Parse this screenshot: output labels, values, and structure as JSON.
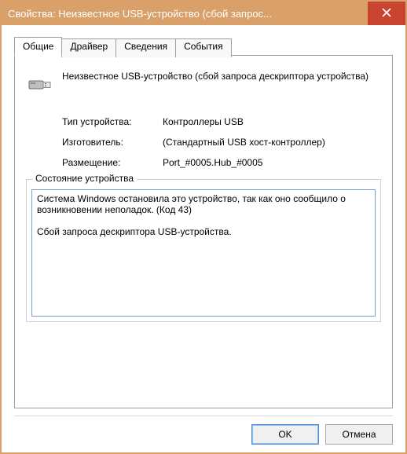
{
  "window": {
    "title": "Свойства: Неизвестное USB-устройство (сбой запрос..."
  },
  "tabs": [
    {
      "label": "Общие"
    },
    {
      "label": "Драйвер"
    },
    {
      "label": "Сведения"
    },
    {
      "label": "События"
    }
  ],
  "device": {
    "name": "Неизвестное USB-устройство (сбой запроса дескриптора устройства)"
  },
  "info": {
    "type_label": "Тип устройства:",
    "type_value": "Контроллеры USB",
    "mfr_label": "Изготовитель:",
    "mfr_value": "(Стандартный USB хост-контроллер)",
    "loc_label": "Размещение:",
    "loc_value": "Port_#0005.Hub_#0005"
  },
  "status": {
    "group_label": "Состояние устройства",
    "text": "Система Windows остановила это устройство, так как оно сообщило о возникновении неполадок. (Код 43)\n\nСбой запроса дескриптора USB-устройства."
  },
  "buttons": {
    "ok": "OK",
    "cancel": "Отмена"
  }
}
